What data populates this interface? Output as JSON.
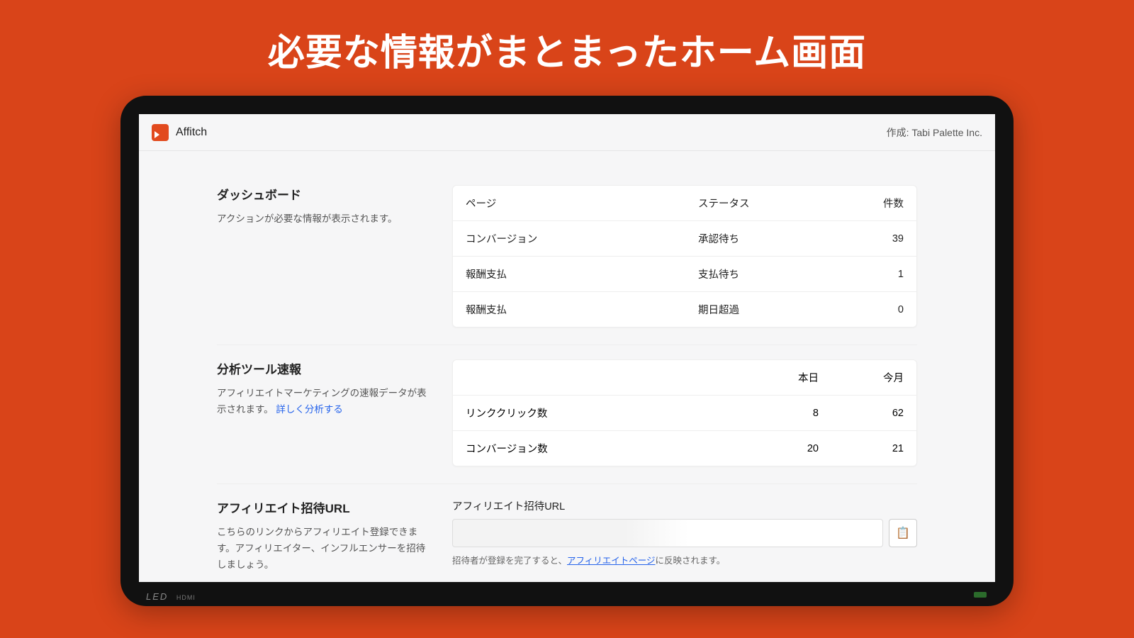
{
  "hero": "必要な情報がまとまったホーム画面",
  "brand": "Affitch",
  "creator_label": "作成: Tabi Palette Inc.",
  "tablet": {
    "branding": "LED",
    "port": "HDMI"
  },
  "dashboard": {
    "title": "ダッシュボード",
    "desc": "アクションが必要な情報が表示されます。",
    "headers": {
      "page": "ページ",
      "status": "ステータス",
      "count": "件数"
    },
    "rows": [
      {
        "page": "コンバージョン",
        "status": "承認待ち",
        "count": "39"
      },
      {
        "page": "報酬支払",
        "status": "支払待ち",
        "count": "1"
      },
      {
        "page": "報酬支払",
        "status": "期日超過",
        "count": "0"
      }
    ]
  },
  "analytics": {
    "title": "分析ツール速報",
    "desc": "アフィリエイトマーケティングの速報データが表示されます。",
    "link": "詳しく分析する",
    "headers": {
      "today": "本日",
      "month": "今月"
    },
    "rows": [
      {
        "label": "リンククリック数",
        "today": "8",
        "month": "62"
      },
      {
        "label": "コンバージョン数",
        "today": "20",
        "month": "21"
      }
    ]
  },
  "invite": {
    "title": "アフィリエイト招待URL",
    "desc": "こちらのリンクからアフィリエイト登録できます。アフィリエイター、インフルエンサーを招待しましょう。",
    "field_label": "アフィリエイト招待URL",
    "value": "",
    "hint_pre": "招待者が登録を完了すると、",
    "hint_link": "アフィリエイトページ",
    "hint_post": "に反映されます。",
    "copy_icon": "📋"
  }
}
